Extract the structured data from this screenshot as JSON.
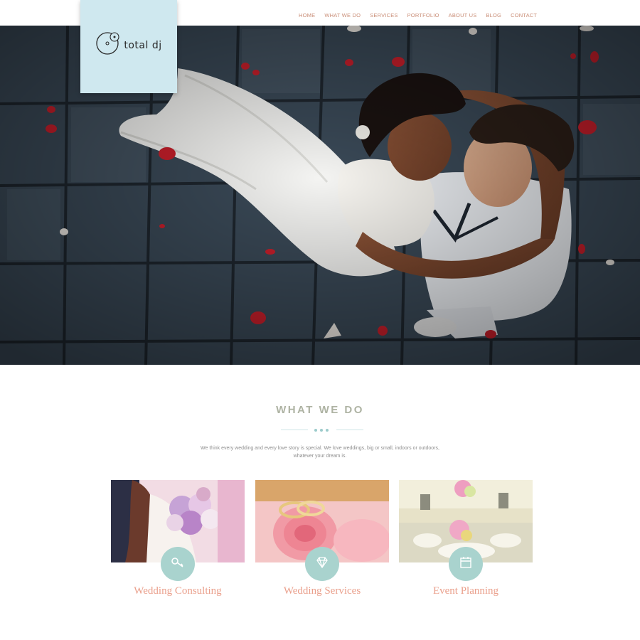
{
  "nav": {
    "items": [
      "HOME",
      "WHAT WE DO",
      "SERVICES",
      "PORTFOLIO",
      "ABOUT US",
      "BLOG",
      "CONTACT"
    ]
  },
  "logo": {
    "text": "total dj",
    "icon": "vinyl-disc-icon"
  },
  "hero": {
    "image": "wedding couple embracing on stone floor with rose petals"
  },
  "what_we_do": {
    "title": "WHAT WE DO",
    "intro_line1": "We think every wedding and every love story is special. We love weddings, big or small, indoors or outdoors,",
    "intro_line2": "whatever your dream is.",
    "cards": [
      {
        "label": "Wedding Consulting",
        "icon": "key-icon"
      },
      {
        "label": "Wedding Services",
        "icon": "diamond-icon"
      },
      {
        "label": "Event Planning",
        "icon": "calendar-icon"
      }
    ]
  },
  "colors": {
    "accent": "#ea9f8b",
    "nav": "#c98d76",
    "logo_bg": "#cfe8ef",
    "icon_circle": "#a9d3ce",
    "title": "#aeb3a3"
  }
}
